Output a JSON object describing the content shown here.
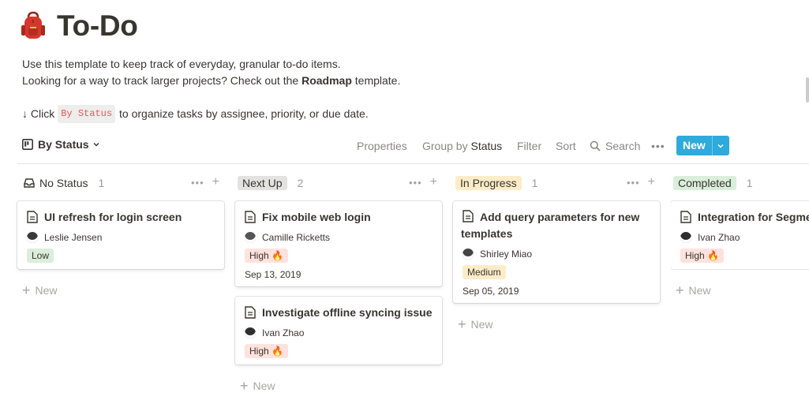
{
  "page": {
    "icon": "backpack-icon",
    "title": "To-Do",
    "description_line1": "Use this template to keep track of everyday, granular to-do items.",
    "description_line2_prefix": "Looking for a way to track larger projects? Check out the ",
    "description_line2_bold": "Roadmap",
    "description_line2_suffix": " template.",
    "hint_prefix": "↓ Click",
    "hint_code": "By Status",
    "hint_suffix": "to organize tasks by assignee, priority, or due date."
  },
  "toolbar": {
    "view_name": "By Status",
    "properties": "Properties",
    "group_by_prefix": "Group by",
    "group_by_value": "Status",
    "filter": "Filter",
    "sort": "Sort",
    "search": "Search",
    "more": "•••",
    "new_label": "New",
    "accent_color": "#2eaadc"
  },
  "columns": [
    {
      "name": "No Status",
      "count": "1",
      "pill_bg": "",
      "cards": [
        {
          "title": "UI refresh for login screen",
          "assignee": "Leslie Jensen",
          "tag": "Low",
          "tag_bg": "#dbeddb",
          "date": ""
        }
      ],
      "add_label": "New"
    },
    {
      "name": "Next Up",
      "count": "2",
      "pill_bg": "#e3e2e0",
      "cards": [
        {
          "title": "Fix mobile web login",
          "assignee": "Camille Ricketts",
          "tag": "High 🔥",
          "tag_bg": "#ffe2dd",
          "date": "Sep 13, 2019"
        },
        {
          "title": "Investigate offline syncing issue",
          "assignee": "Ivan Zhao",
          "tag": "High 🔥",
          "tag_bg": "#ffe2dd",
          "date": ""
        }
      ],
      "add_label": "New"
    },
    {
      "name": "In Progress",
      "count": "1",
      "pill_bg": "#fdecc8",
      "cards": [
        {
          "title": "Add query parameters for new templates",
          "assignee": "Shirley Miao",
          "tag": "Medium",
          "tag_bg": "#fdecc8",
          "date": "Sep 05, 2019"
        }
      ],
      "add_label": "New"
    },
    {
      "name": "Completed",
      "count": "1",
      "pill_bg": "#dbeddb",
      "cards": [
        {
          "title": "Integration for Segment",
          "assignee": "Ivan Zhao",
          "tag": "High 🔥",
          "tag_bg": "#ffe2dd",
          "date": ""
        }
      ],
      "add_label": "New"
    }
  ]
}
